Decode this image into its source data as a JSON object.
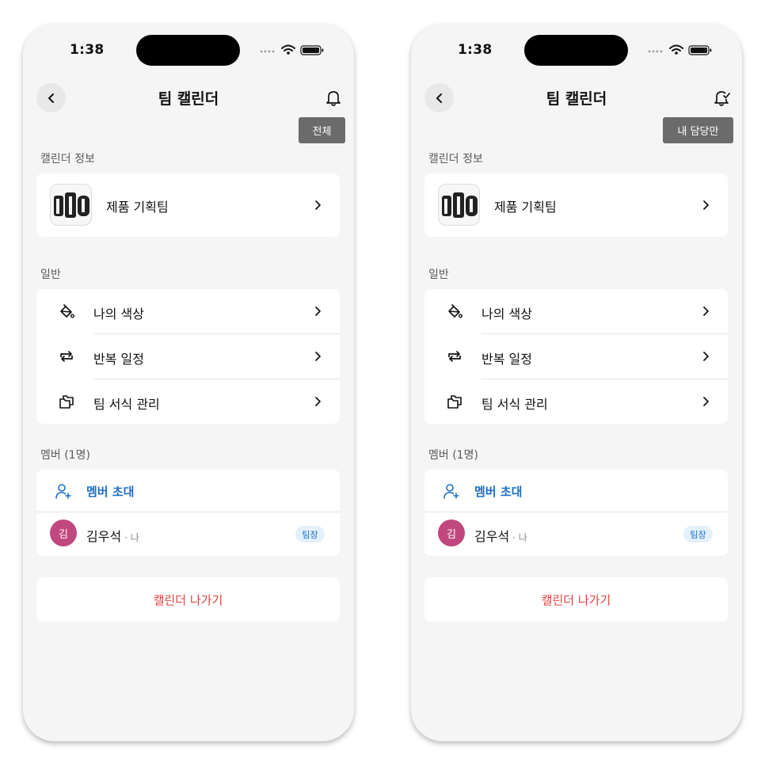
{
  "screens": [
    {
      "status_bar": {
        "time": "1:38"
      },
      "nav": {
        "title": "팀 캘린더",
        "bell_icon": "bell-icon"
      },
      "tooltip": {
        "label": "전체"
      },
      "calendar_info": {
        "section_label": "캘린더 정보",
        "team_name": "제품 기획팀"
      },
      "general": {
        "section_label": "일반",
        "items": [
          {
            "label": "나의 색상",
            "icon": "paint-bucket-icon"
          },
          {
            "label": "반복 일정",
            "icon": "repeat-icon"
          },
          {
            "label": "팀 서식 관리",
            "icon": "folder-copy-icon"
          }
        ]
      },
      "members": {
        "section_label": "멤버 (1명)",
        "invite_label": "멤버 초대",
        "list": [
          {
            "avatar": "김",
            "name": "김우석",
            "suffix": "· 나",
            "role": "팀장"
          }
        ]
      },
      "leave_label": "캘린더 나가기"
    },
    {
      "status_bar": {
        "time": "1:38"
      },
      "nav": {
        "title": "팀 캘린더",
        "bell_icon": "bell-filter-icon"
      },
      "tooltip": {
        "label": "내 담당만"
      },
      "calendar_info": {
        "section_label": "캘린더 정보",
        "team_name": "제품 기획팀"
      },
      "general": {
        "section_label": "일반",
        "items": [
          {
            "label": "나의 색상",
            "icon": "paint-bucket-icon"
          },
          {
            "label": "반복 일정",
            "icon": "repeat-icon"
          },
          {
            "label": "팀 서식 관리",
            "icon": "folder-copy-icon"
          }
        ]
      },
      "members": {
        "section_label": "멤버 (1명)",
        "invite_label": "멤버 초대",
        "list": [
          {
            "avatar": "김",
            "name": "김우석",
            "suffix": "· 나",
            "role": "팀장"
          }
        ]
      },
      "leave_label": "캘린더 나가기"
    }
  ],
  "colors": {
    "accent_blue": "#1d6fc4",
    "danger_red": "#e0433e",
    "avatar_pink": "#c0487e",
    "tooltip_gray": "#6b6b6b"
  }
}
